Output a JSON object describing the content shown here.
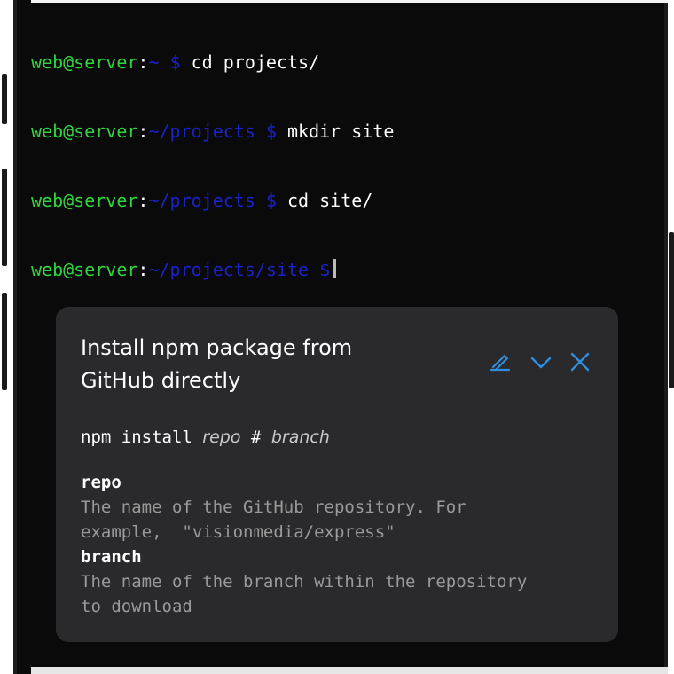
{
  "terminal": {
    "lines": [
      {
        "user": "web@server",
        "colon": ":",
        "path": "~ $",
        "cmd": "cd projects/"
      },
      {
        "user": "web@server",
        "colon": ":",
        "path": "~/projects $",
        "cmd": "mkdir site"
      },
      {
        "user": "web@server",
        "colon": ":",
        "path": "~/projects $",
        "cmd": "cd site/"
      },
      {
        "user": "web@server",
        "colon": ":",
        "path": "~/projects/site $",
        "cmd": ""
      }
    ]
  },
  "card": {
    "title_line1": "Install npm package from",
    "title_line2": "GitHub directly",
    "syntax": {
      "cmd": "npm install",
      "arg1": "repo",
      "sep": "#",
      "arg2": "branch"
    },
    "params": [
      {
        "name": "repo",
        "desc": "The name of the GitHub repository. For\nexample,  \"visionmedia/express\""
      },
      {
        "name": "branch",
        "desc": "The name of the branch within the repository\nto download"
      }
    ],
    "icons": {
      "edit": "pencil-icon",
      "collapse": "chevron-down-icon",
      "close": "close-icon"
    }
  },
  "colors": {
    "user": "#31d43f",
    "path": "#1b22c8",
    "accent": "#2e8ee0",
    "card_bg": "#2a2a2c",
    "terminal_bg": "#0a0a0a"
  }
}
